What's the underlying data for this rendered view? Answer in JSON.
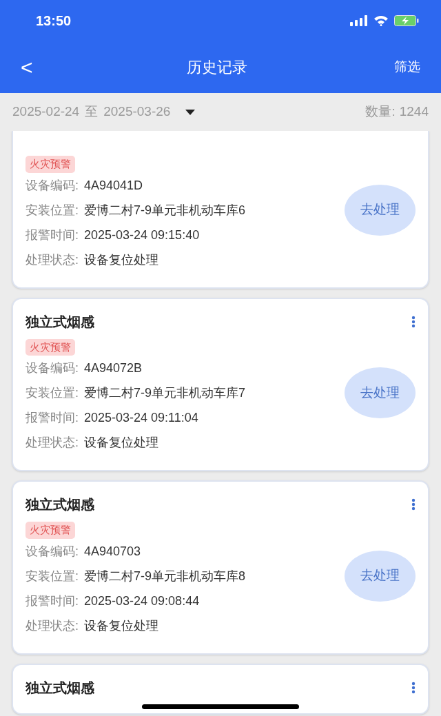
{
  "status_bar": {
    "time": "13:50"
  },
  "header": {
    "back": "<",
    "title": "历史记录",
    "action": "筛选"
  },
  "filter_bar": {
    "date_from": "2025-02-24",
    "separator": "至",
    "date_to": "2025-03-26",
    "count_label": "数量:",
    "count": "1244"
  },
  "cards": [
    {
      "tag": "火灾预警",
      "fields": [
        {
          "label": "设备编码:",
          "value": "4A94041D"
        },
        {
          "label": "安装位置:",
          "value": "爱博二村7-9单元非机动车库6"
        },
        {
          "label": "报警时间:",
          "value": "2025-03-24 09:15:40"
        },
        {
          "label": "处理状态:",
          "value": "设备复位处理"
        }
      ],
      "button": "去处理"
    },
    {
      "title": "独立式烟感",
      "tag": "火灾预警",
      "fields": [
        {
          "label": "设备编码:",
          "value": "4A94072B"
        },
        {
          "label": "安装位置:",
          "value": "爱博二村7-9单元非机动车库7"
        },
        {
          "label": "报警时间:",
          "value": "2025-03-24 09:11:04"
        },
        {
          "label": "处理状态:",
          "value": "设备复位处理"
        }
      ],
      "button": "去处理"
    },
    {
      "title": "独立式烟感",
      "tag": "火灾预警",
      "fields": [
        {
          "label": "设备编码:",
          "value": "4A940703"
        },
        {
          "label": "安装位置:",
          "value": "爱博二村7-9单元非机动车库8"
        },
        {
          "label": "报警时间:",
          "value": "2025-03-24 09:08:44"
        },
        {
          "label": "处理状态:",
          "value": "设备复位处理"
        }
      ],
      "button": "去处理"
    },
    {
      "title": "独立式烟感"
    }
  ]
}
